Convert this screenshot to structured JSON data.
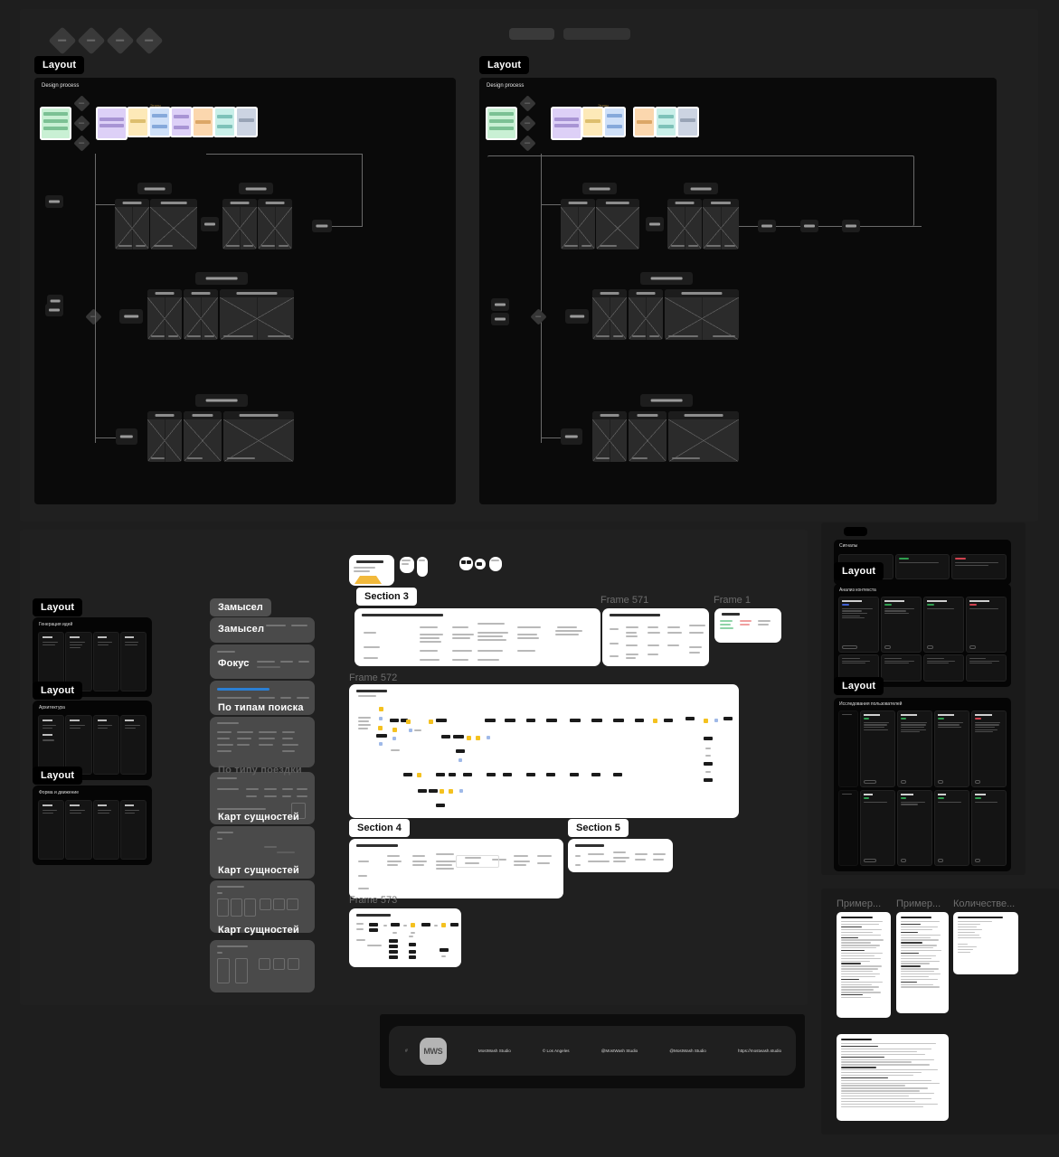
{
  "app": {
    "background": "#1e1e1e",
    "panel": "#202020",
    "accent": "#2b7fd4"
  },
  "top_section": {
    "diamond_count": 4,
    "toolbar_pills": [
      "",
      ""
    ],
    "boards": [
      {
        "label": "Layout",
        "title": "Design process",
        "flow_label": "Этапы"
      },
      {
        "label": "Layout",
        "title": "Design process",
        "flow_label": "Этапы"
      }
    ],
    "notes": [
      {
        "color": "#c9f0d4",
        "name": "note-green"
      },
      {
        "color": "#ddd0f7",
        "name": "note-purple"
      },
      {
        "color": "#fde9b8",
        "name": "note-yellow"
      },
      {
        "color": "#cfe0f8",
        "name": "note-blue"
      },
      {
        "color": "#ddd0f7",
        "name": "note-purple-2"
      },
      {
        "color": "#fbd7ae",
        "name": "note-orange"
      },
      {
        "color": "#c9efe9",
        "name": "note-teal"
      },
      {
        "color": "#ccd4e2",
        "name": "note-greyblue"
      }
    ]
  },
  "mid_section": {
    "left_column": {
      "labels": [
        "Layout",
        "Layout",
        "Layout"
      ],
      "panels": [
        {
          "title": "Генерация идей"
        },
        {
          "title": "Архитектура"
        },
        {
          "title": "Форма и движение"
        }
      ]
    },
    "idea_column": {
      "chip": "Замысел",
      "cards": [
        {
          "label": "Замысел",
          "overlay": false
        },
        {
          "label": "Фокус",
          "overlay": false
        },
        {
          "label": "По типам поиска",
          "overlay": false,
          "accent_bar": true
        },
        {
          "label": "По типу поездки",
          "overlay": true
        },
        {
          "label": "Карт сущностей",
          "overlay": false
        },
        {
          "label": "Карт сущностей",
          "overlay": false
        },
        {
          "label": "Карт сущностей",
          "overlay": false
        },
        {
          "label": "",
          "overlay": false
        }
      ]
    },
    "doc_frames": [
      {
        "label": "Section 3",
        "style": "white-chip"
      },
      {
        "label": "Frame 571",
        "style": "ghost"
      },
      {
        "label": "Frame 1",
        "style": "ghost"
      },
      {
        "label": "Frame 572",
        "style": "ghost"
      },
      {
        "label": "Section 4",
        "style": "white-chip"
      },
      {
        "label": "Section 5",
        "style": "white-chip"
      },
      {
        "label": "Frame 573",
        "style": "ghost"
      }
    ]
  },
  "right_section": {
    "panels": [
      {
        "title": "Сигналы",
        "label": "Layout"
      },
      {
        "title": "Анализ контекста",
        "label": "Layout"
      },
      {
        "title": "Исследования пользователей",
        "label": ""
      }
    ],
    "doc_labels": [
      "Пример...",
      "Пример...",
      "Количестве..."
    ]
  },
  "footer": {
    "hash": "#",
    "avatar_initials": "MWS",
    "items": [
      "MostWash Studio",
      "© Los Angeles",
      "@MostWash Studio",
      "@MostWash Studio",
      "https://mostwash.studio"
    ]
  }
}
